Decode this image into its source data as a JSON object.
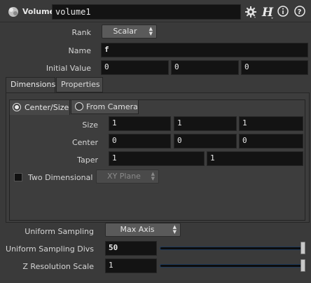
{
  "header": {
    "node_type": "Volume",
    "node_name": "volume1"
  },
  "params": {
    "rank_label": "Rank",
    "rank_value": "Scalar",
    "name_label": "Name",
    "name_value": "f",
    "initial_value_label": "Initial Value",
    "initial_value": [
      "0",
      "0",
      "0"
    ]
  },
  "tabs": [
    {
      "label": "Dimensions",
      "active": true
    },
    {
      "label": "Properties",
      "active": false
    }
  ],
  "dimensions": {
    "mode_options": [
      "Center/Size",
      "From Camera"
    ],
    "mode_selected": "Center/Size",
    "size_label": "Size",
    "size": [
      "1",
      "1",
      "1"
    ],
    "center_label": "Center",
    "center": [
      "0",
      "0",
      "0"
    ],
    "taper_label": "Taper",
    "taper": [
      "1",
      "1"
    ],
    "two_dimensional_label": "Two Dimensional",
    "two_dimensional_checked": false,
    "plane_value": "XY Plane"
  },
  "sampling": {
    "uniform_sampling_label": "Uniform Sampling",
    "uniform_sampling_value": "Max Axis",
    "divs_label": "Uniform Sampling Divs",
    "divs_value": "50",
    "z_res_label": "Z Resolution Scale",
    "z_res_value": "1"
  },
  "icons": [
    "volume-node-icon",
    "gear-icon",
    "help-h-icon",
    "info-icon",
    "question-icon"
  ],
  "colors": {
    "background": "#3a3a3a",
    "field": "#131313",
    "slider_accent": "#1e3a5c"
  }
}
